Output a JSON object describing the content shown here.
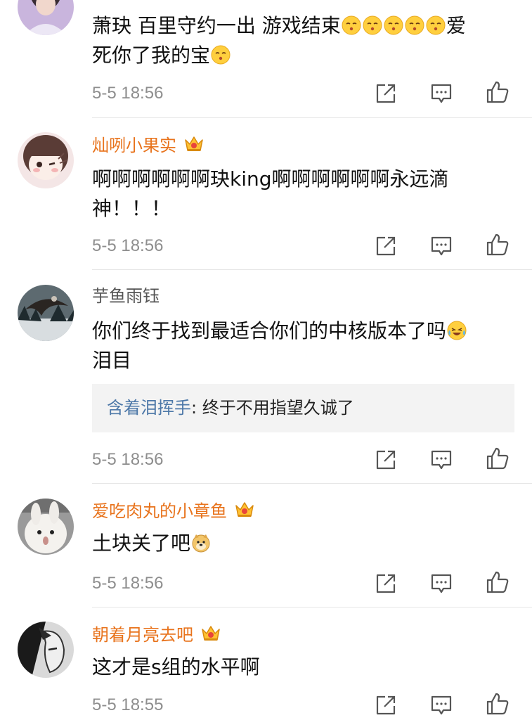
{
  "comments": [
    {
      "text_a": "萧玦 百里守约一出 游戏结束",
      "text_b": "爱",
      "text_c": "死你了我的宝",
      "time": "5-5 18:56"
    },
    {
      "username": "灿咧小果实",
      "text_a": "啊啊啊啊啊啊玦king啊啊啊啊啊啊永远滴",
      "text_b": "神！！！",
      "time": "5-5 18:56"
    },
    {
      "username": "芋鱼雨钰",
      "text_a": "你们终于找到最适合你们的中核版本了吗",
      "text_b": "泪目",
      "reply": {
        "user": "含着泪挥手",
        "sep": ": ",
        "text": "终于不用指望久诚了"
      },
      "time": "5-5 18:56"
    },
    {
      "username": "爱吃肉丸的小章鱼",
      "text_a": "土块关了吧",
      "time": "5-5 18:56"
    },
    {
      "username": "朝着月亮去吧",
      "text_a": "这才是s组的水平啊",
      "time": "5-5 18:55"
    }
  ],
  "icons": {
    "share": "share-icon",
    "comment": "comment-icon",
    "like": "like-icon",
    "crown": "crown-icon"
  },
  "colors": {
    "vip_name": "#e8731c",
    "normal_name": "#555555",
    "reply_user": "#4d78a8",
    "meta": "#8e8e8e"
  }
}
